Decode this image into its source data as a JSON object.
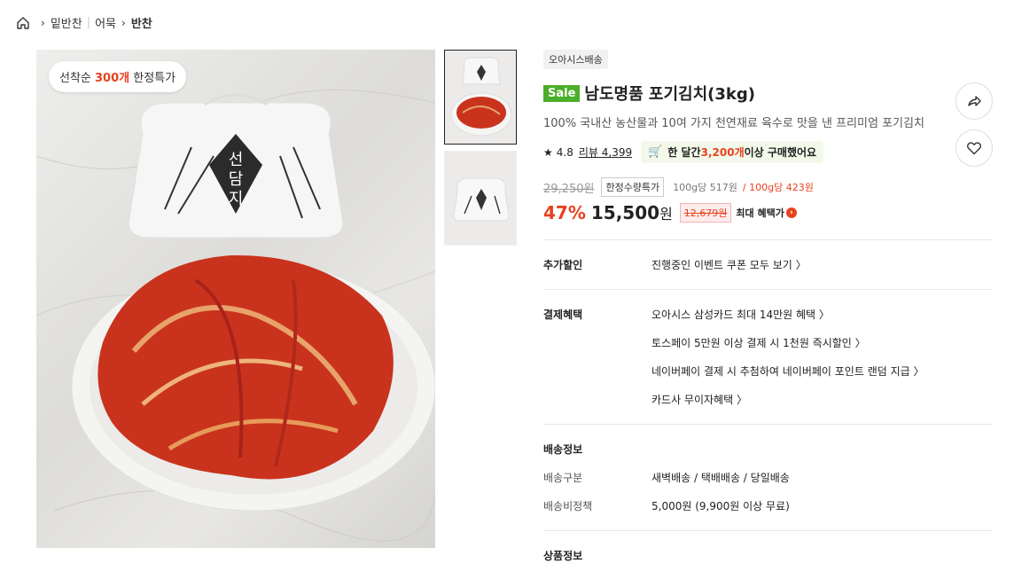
{
  "breadcrumb": {
    "level1": "밑반찬",
    "level2": "어묵",
    "current": "반찬"
  },
  "main_image": {
    "bubble_prefix": "선착순 ",
    "bubble_highlight": "300개",
    "bubble_suffix": " 한정특가"
  },
  "product": {
    "delivery_tag": "오아시스배송",
    "sale_badge": "Sale",
    "title": "남도명품 포기김치(3kg)",
    "subtitle": "100% 국내산 농산물과 10여 가지 천연재료 육수로 맛을 낸 프리미엄 포기김치",
    "rating": "4.8",
    "review_label": "리뷰 4,399",
    "buy_prefix": "한 달간 ",
    "buy_count": "3,200개",
    "buy_suffix": " 이상 구매했어요",
    "original_price": "29,250원",
    "limited_tag": "한정수량특가",
    "unit_price": "100g당 517원",
    "unit_sale_price": "/ 100g당 423원",
    "discount": "47%",
    "price": "15,500",
    "price_unit": "원",
    "benefit_price": "12,679원",
    "benefit_label": "최대 혜택가"
  },
  "extra_discount": {
    "label": "추가할인",
    "items": [
      "진행중인 이벤트 쿠폰 모두 보기 〉"
    ]
  },
  "payment_benefits": {
    "label": "결제혜택",
    "items": [
      "오아시스 삼성카드 최대 14만원 혜택 〉",
      "토스페이 5만원 이상 결제 시 1천원 즉시할인 〉",
      "네이버페이 결제 시 추첨하여 네이버페이 포인트 랜덤 지급 〉",
      "카드사 무이자혜택 〉"
    ]
  },
  "shipping": {
    "heading": "배송정보",
    "method_label": "배송구분",
    "method_value": "새벽배송 / 택배배송 / 당일배송",
    "fee_label": "배송비정책",
    "fee_value": "5,000원 (9,900원 이상 무료)"
  },
  "product_info_heading": "상품정보",
  "colors": {
    "accent": "#e8421f",
    "sale_green": "#4caf2a"
  }
}
